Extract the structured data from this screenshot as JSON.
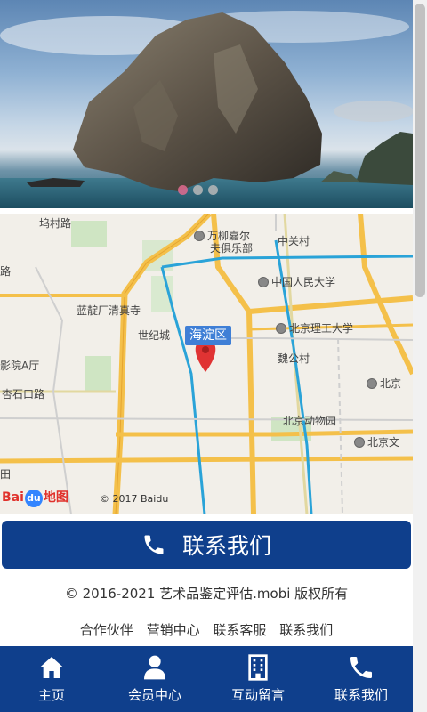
{
  "banner": {
    "slide_count": 3,
    "active_slide": 1
  },
  "map": {
    "district_label": "海淀区",
    "places": {
      "wanliu": "万柳嘉尔",
      "wanliu2": "夫俱乐部",
      "zhongguancun": "中关村",
      "renmin": "中国人民大学",
      "lanjing": "蓝靛厂清真寺",
      "shijicheng": "世纪城",
      "ligong": "北京理工大学",
      "weigongcun": "魏公村",
      "yingyuan": "影院A厅",
      "xingshikou": "杏石口路",
      "dongwuyuan": "北京动物园",
      "beijingzhan": "北京文",
      "beijing": "北京",
      "cun": "坞村路",
      "lu": "路",
      "tian": "田"
    },
    "logo_text_1": "Bai",
    "logo_text_2": "du",
    "logo_text_3": "地图",
    "copyright": "© 2017 Baidu"
  },
  "contact_button": {
    "label": "联系我们"
  },
  "footer": {
    "copyright": "© 2016-2021 艺术品鉴定评估.mobi 版权所有",
    "links": [
      "合作伙伴",
      "营销中心",
      "联系客服",
      "联系我们"
    ]
  },
  "bottom_nav": {
    "items": [
      {
        "label": "主页",
        "icon": "home-icon"
      },
      {
        "label": "会员中心",
        "icon": "user-icon"
      },
      {
        "label": "互动留言",
        "icon": "building-icon"
      },
      {
        "label": "联系我们",
        "icon": "phone-icon"
      }
    ]
  },
  "colors": {
    "brand": "#0f3f8c",
    "dot_active": "#e06a8f"
  }
}
